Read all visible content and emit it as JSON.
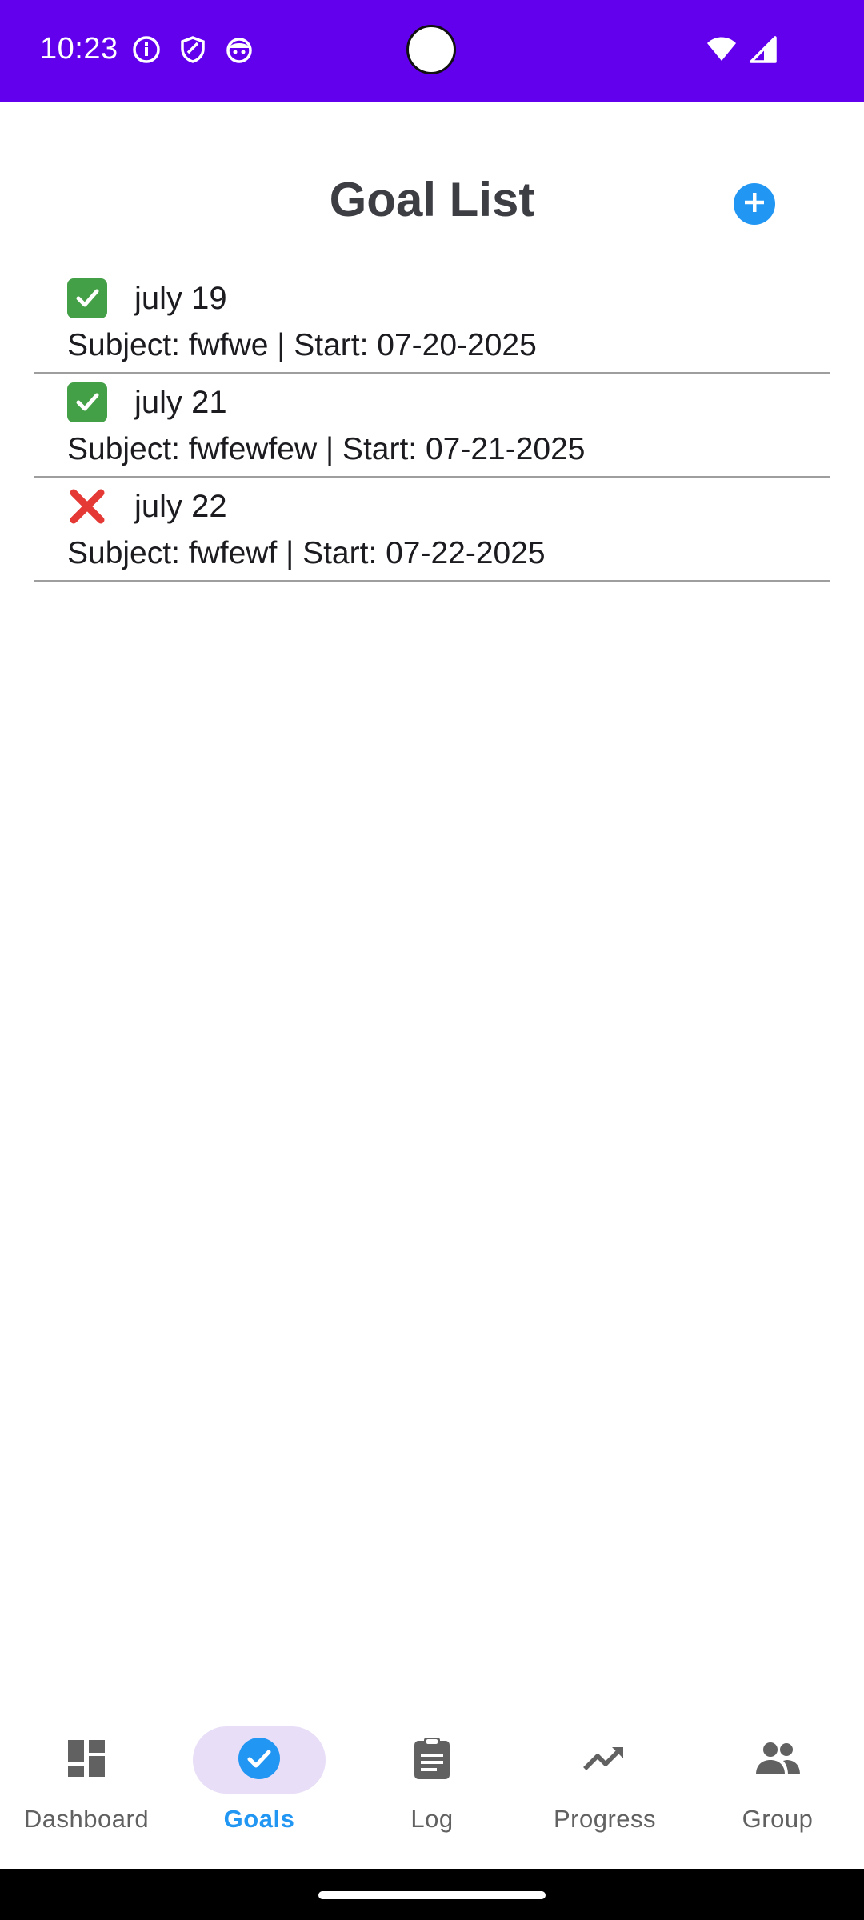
{
  "status_bar": {
    "time": "10:23",
    "left_icons": [
      "info-icon",
      "shield-icon",
      "android-face-icon"
    ],
    "right_icons": [
      "wifi-icon",
      "signal-icon"
    ]
  },
  "header": {
    "title": "Goal List",
    "add_icon": "plus-circle-icon",
    "add_color": "#2196f3"
  },
  "goals": [
    {
      "status": "done",
      "status_icon": "check-icon",
      "title": "july 19",
      "subtitle": "Subject: fwfwe | Start: 07-20-2025"
    },
    {
      "status": "done",
      "status_icon": "check-icon",
      "title": "july 21",
      "subtitle": "Subject: fwfewfew | Start: 07-21-2025"
    },
    {
      "status": "fail",
      "status_icon": "cross-icon",
      "title": "july 22",
      "subtitle": "Subject: fwfewf | Start: 07-22-2025"
    }
  ],
  "nav": {
    "active": "Goals",
    "items": [
      {
        "label": "Dashboard",
        "icon": "dashboard-icon"
      },
      {
        "label": "Goals",
        "icon": "check-circle-icon"
      },
      {
        "label": "Log",
        "icon": "clipboard-icon"
      },
      {
        "label": "Progress",
        "icon": "trending-up-icon"
      },
      {
        "label": "Group",
        "icon": "group-icon"
      }
    ]
  },
  "colors": {
    "status_bar": "#6200ee",
    "accent": "#2196f3",
    "active_pill": "#e8def8",
    "done": "#43a047",
    "fail": "#e53935"
  }
}
